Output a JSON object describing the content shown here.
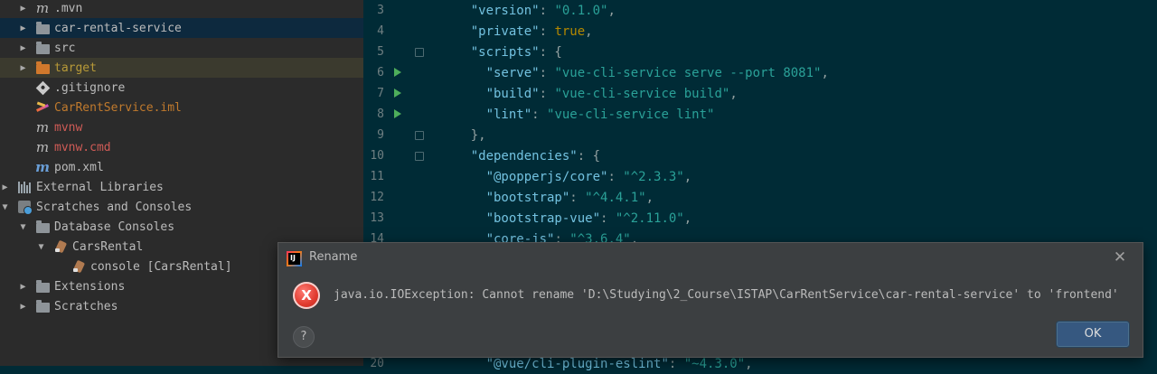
{
  "tree": {
    "items": [
      {
        "label": ".mvn",
        "icon": "maven-folder-icon",
        "arrow": "collapsed",
        "indent": 1,
        "state": "default"
      },
      {
        "label": "car-rental-service",
        "icon": "folder-icon",
        "arrow": "collapsed",
        "indent": 1,
        "state": "selected"
      },
      {
        "label": "src",
        "icon": "folder-icon",
        "arrow": "collapsed",
        "indent": 1,
        "state": "default"
      },
      {
        "label": "target",
        "icon": "excluded-folder-icon",
        "arrow": "collapsed",
        "indent": 1,
        "state": "ignored"
      },
      {
        "label": ".gitignore",
        "icon": "git-icon",
        "arrow": "none",
        "indent": 1,
        "state": "default"
      },
      {
        "label": "CarRentService.iml",
        "icon": "iml-icon",
        "arrow": "none",
        "indent": 1,
        "state": "modified"
      },
      {
        "label": "mvnw",
        "icon": "maven-file-icon",
        "arrow": "none",
        "indent": 1,
        "state": "untracked"
      },
      {
        "label": "mvnw.cmd",
        "icon": "maven-file-icon",
        "arrow": "none",
        "indent": 1,
        "state": "untracked"
      },
      {
        "label": "pom.xml",
        "icon": "maven-pom-icon",
        "arrow": "none",
        "indent": 1,
        "state": "default"
      },
      {
        "label": "External Libraries",
        "icon": "libraries-icon",
        "arrow": "collapsed",
        "indent": 0,
        "state": "default"
      },
      {
        "label": "Scratches and Consoles",
        "icon": "scratches-icon",
        "arrow": "expanded",
        "indent": 0,
        "state": "default"
      },
      {
        "label": "Database Consoles",
        "icon": "folder-icon",
        "arrow": "expanded",
        "indent": 1,
        "state": "default"
      },
      {
        "label": "CarsRental",
        "icon": "database-icon",
        "arrow": "expanded",
        "indent": 2,
        "state": "default"
      },
      {
        "label": "console [CarsRental]",
        "icon": "database-console-icon",
        "arrow": "none",
        "indent": 3,
        "state": "default"
      },
      {
        "label": "Extensions",
        "icon": "folder-icon",
        "arrow": "collapsed",
        "indent": 1,
        "state": "default"
      },
      {
        "label": "Scratches",
        "icon": "folder-icon",
        "arrow": "collapsed",
        "indent": 1,
        "state": "default"
      }
    ]
  },
  "editor": {
    "lines": [
      {
        "num": "3",
        "gutter": "",
        "tokens": [
          [
            "    ",
            "punc"
          ],
          [
            "\"version\"",
            "key"
          ],
          [
            ": ",
            "punc"
          ],
          [
            "\"0.1.0\"",
            "str"
          ],
          [
            ",",
            "punc"
          ]
        ]
      },
      {
        "num": "4",
        "gutter": "",
        "tokens": [
          [
            "    ",
            "punc"
          ],
          [
            "\"private\"",
            "key"
          ],
          [
            ": ",
            "punc"
          ],
          [
            "true",
            "bool"
          ],
          [
            ",",
            "punc"
          ]
        ]
      },
      {
        "num": "5",
        "gutter": "fold",
        "tokens": [
          [
            "    ",
            "punc"
          ],
          [
            "\"scripts\"",
            "key"
          ],
          [
            ": {",
            "punc"
          ]
        ]
      },
      {
        "num": "6",
        "gutter": "run",
        "tokens": [
          [
            "      ",
            "punc"
          ],
          [
            "\"serve\"",
            "key"
          ],
          [
            ": ",
            "punc"
          ],
          [
            "\"vue-cli-service serve --port 8081\"",
            "str"
          ],
          [
            ",",
            "punc"
          ]
        ]
      },
      {
        "num": "7",
        "gutter": "run",
        "tokens": [
          [
            "      ",
            "punc"
          ],
          [
            "\"build\"",
            "key"
          ],
          [
            ": ",
            "punc"
          ],
          [
            "\"vue-cli-service build\"",
            "str"
          ],
          [
            ",",
            "punc"
          ]
        ]
      },
      {
        "num": "8",
        "gutter": "run",
        "tokens": [
          [
            "      ",
            "punc"
          ],
          [
            "\"lint\"",
            "key"
          ],
          [
            ": ",
            "punc"
          ],
          [
            "\"vue-cli-service lint\"",
            "str"
          ]
        ]
      },
      {
        "num": "9",
        "gutter": "fold",
        "tokens": [
          [
            "    ",
            "punc"
          ],
          [
            "},",
            "punc"
          ]
        ]
      },
      {
        "num": "10",
        "gutter": "fold",
        "tokens": [
          [
            "    ",
            "punc"
          ],
          [
            "\"dependencies\"",
            "key"
          ],
          [
            ": {",
            "punc"
          ]
        ]
      },
      {
        "num": "11",
        "gutter": "",
        "tokens": [
          [
            "      ",
            "punc"
          ],
          [
            "\"@popperjs/core\"",
            "key"
          ],
          [
            ": ",
            "punc"
          ],
          [
            "\"^2.3.3\"",
            "str"
          ],
          [
            ",",
            "punc"
          ]
        ]
      },
      {
        "num": "12",
        "gutter": "",
        "tokens": [
          [
            "      ",
            "punc"
          ],
          [
            "\"bootstrap\"",
            "key"
          ],
          [
            ": ",
            "punc"
          ],
          [
            "\"^4.4.1\"",
            "str"
          ],
          [
            ",",
            "punc"
          ]
        ]
      },
      {
        "num": "13",
        "gutter": "",
        "tokens": [
          [
            "      ",
            "punc"
          ],
          [
            "\"bootstrap-vue\"",
            "key"
          ],
          [
            ": ",
            "punc"
          ],
          [
            "\"^2.11.0\"",
            "str"
          ],
          [
            ",",
            "punc"
          ]
        ]
      },
      {
        "num": "14",
        "gutter": "",
        "tokens": [
          [
            "      ",
            "punc"
          ],
          [
            "\"core-js\"",
            "key"
          ],
          [
            ": ",
            "punc"
          ],
          [
            "\"^3.6.4\"",
            "str"
          ],
          [
            ",",
            "punc"
          ]
        ]
      },
      {
        "num": "",
        "gutter": "",
        "tokens": []
      },
      {
        "num": "",
        "gutter": "",
        "tokens": []
      },
      {
        "num": "",
        "gutter": "",
        "tokens": []
      },
      {
        "num": "",
        "gutter": "",
        "tokens": []
      },
      {
        "num": "",
        "gutter": "",
        "tokens": []
      },
      {
        "num": "20",
        "gutter": "",
        "tokens": [
          [
            "      ",
            "punc"
          ],
          [
            "\"@vue/cli-plugin-eslint\"",
            "key"
          ],
          [
            ": ",
            "punc"
          ],
          [
            "\"~4.3.0\"",
            "str"
          ],
          [
            ",",
            "punc"
          ]
        ]
      }
    ]
  },
  "dialog": {
    "title": "Rename",
    "app_logo": "IJ",
    "close_glyph": "✕",
    "error_glyph": "X",
    "message": "java.io.IOException: Cannot rename 'D:\\Studying\\2_Course\\ISTAP\\CarRentService\\car-rental-service' to 'frontend'",
    "help_glyph": "?",
    "ok_label": "OK"
  }
}
